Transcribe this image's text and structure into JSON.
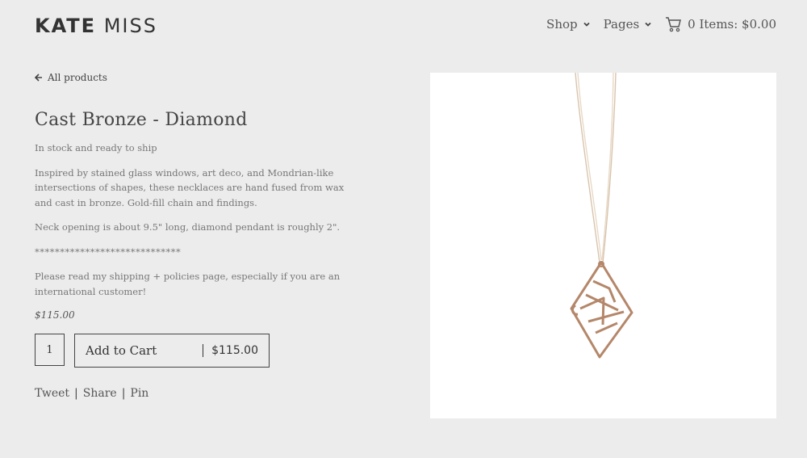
{
  "header": {
    "logo_first": "KATE",
    "logo_second": "MISS",
    "nav": [
      {
        "label": "Shop"
      },
      {
        "label": "Pages"
      }
    ],
    "cart_label": "0 Items: $0.00"
  },
  "product": {
    "back_label": "All products",
    "title": "Cast Bronze - Diamond",
    "stock": "In stock and ready to ship",
    "description": "Inspired by stained glass windows, art deco, and Mondrian-like intersections of shapes, these necklaces are hand fused from wax and cast in bronze. Gold-fill chain and findings.",
    "dimensions": "Neck opening is about 9.5\" long, diamond pendant is roughly 2\".",
    "stars": "*****************************",
    "policy_note": "Please read my shipping + policies page, especially if you are an international customer!",
    "price": "$115.00",
    "quantity": "1",
    "add_to_cart_label": "Add to Cart",
    "add_to_cart_price": "$115.00"
  },
  "social": {
    "tweet": "Tweet",
    "share": "Share",
    "pin": "Pin"
  },
  "icons": {
    "back": "arrow-left-icon",
    "cart": "cart-icon",
    "chevron": "chevron-down-icon"
  }
}
